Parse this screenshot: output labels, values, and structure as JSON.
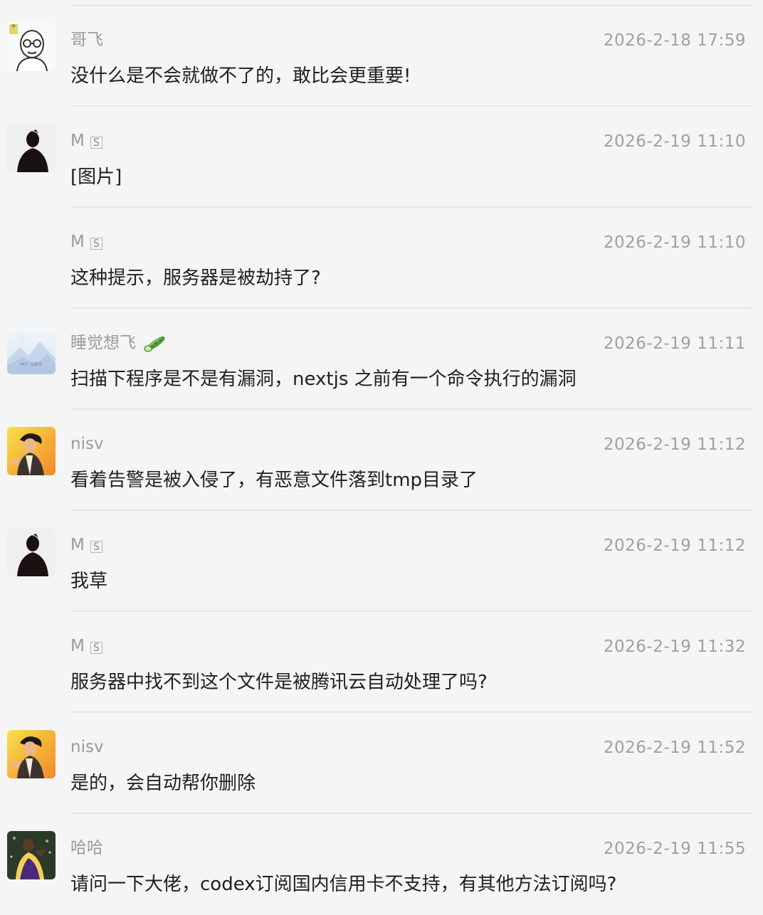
{
  "messages": [
    {
      "sender": "哥飞",
      "time": "2026-2-18 17:59",
      "text": "没什么是不会就做不了的，敢比会更重要!",
      "avatar": "cartoon-bald-man-icon",
      "badge": ""
    },
    {
      "sender": "M",
      "time": "2026-2-19 11:10",
      "text": "[图片]",
      "avatar": "silhouette-person-icon",
      "badge": "S"
    },
    {
      "sender": "M",
      "time": "2026-2-19 11:10",
      "text": "这种提示，服务器是被劫持了?",
      "avatar": "",
      "badge": "S"
    },
    {
      "sender": "睡觉想飞",
      "time": "2026-2-19 11:11",
      "text": "扫描下程序是不是有漏洞，nextjs 之前有一个命令执行的漏洞",
      "avatar": "landscape-placeholder-icon",
      "badge": "",
      "emoji": "cucumber-icon"
    },
    {
      "sender": "nisv",
      "time": "2026-2-19 11:12",
      "text": "看着告警是被入侵了，有恶意文件落到tmp目录了",
      "avatar": "anime-character-icon",
      "badge": ""
    },
    {
      "sender": "M",
      "time": "2026-2-19 11:12",
      "text": "我草",
      "avatar": "silhouette-person-icon",
      "badge": "S"
    },
    {
      "sender": "M",
      "time": "2026-2-19 11:32",
      "text": "服务器中找不到这个文件是被腾讯云自动处理了吗?",
      "avatar": "",
      "badge": "S"
    },
    {
      "sender": "nisv",
      "time": "2026-2-19 11:52",
      "text": "是的，会自动帮你删除",
      "avatar": "anime-character-icon",
      "badge": ""
    },
    {
      "sender": "哈哈",
      "time": "2026-2-19 11:55",
      "text": "请问一下大佬，codex订阅国内信用卡不支持，有其他方法订阅吗?",
      "avatar": "basketball-player-icon",
      "badge": ""
    }
  ],
  "placeholder_avatar_caption": "INIT 加载中"
}
